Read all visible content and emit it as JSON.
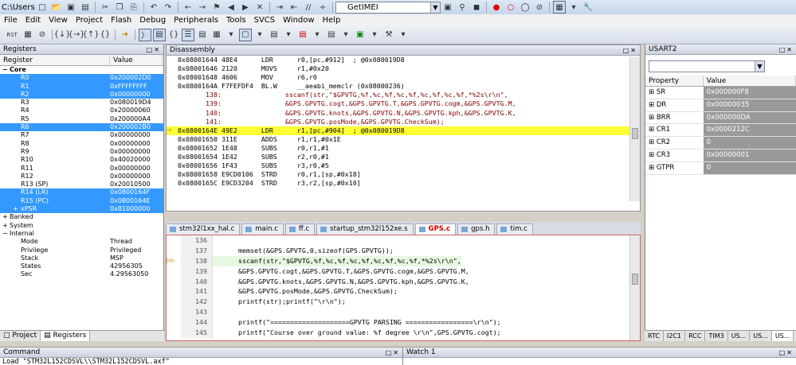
{
  "titlebar": {
    "path": "C:\\Users\\bi",
    "target": "GetIMEI"
  },
  "menu": [
    "File",
    "Edit",
    "View",
    "Project",
    "Flash",
    "Debug",
    "Peripherals",
    "Tools",
    "SVCS",
    "Window",
    "Help"
  ],
  "registers": {
    "title": "Registers",
    "col_register": "Register",
    "col_value": "Value",
    "rows": [
      {
        "name": "Core",
        "value": "",
        "level": 0,
        "exp": "−",
        "bold": true,
        "sel": false
      },
      {
        "name": "R0",
        "value": "0x200002D0",
        "level": 2,
        "exp": "",
        "sel": true
      },
      {
        "name": "R1",
        "value": "0xFFFFFFFF",
        "level": 2,
        "exp": "",
        "sel": true
      },
      {
        "name": "R2",
        "value": "0x00000000",
        "level": 2,
        "exp": "",
        "sel": true
      },
      {
        "name": "R3",
        "value": "0x080019D4",
        "level": 2,
        "exp": "",
        "sel": false
      },
      {
        "name": "R4",
        "value": "0x20000060",
        "level": 2,
        "exp": "",
        "sel": false
      },
      {
        "name": "R5",
        "value": "0x200000A4",
        "level": 2,
        "exp": "",
        "sel": false
      },
      {
        "name": "R6",
        "value": "0x200002B0",
        "level": 2,
        "exp": "",
        "sel": true
      },
      {
        "name": "R7",
        "value": "0x00000000",
        "level": 2,
        "exp": "",
        "sel": false
      },
      {
        "name": "R8",
        "value": "0x00000000",
        "level": 2,
        "exp": "",
        "sel": false
      },
      {
        "name": "R9",
        "value": "0x00000000",
        "level": 2,
        "exp": "",
        "sel": false
      },
      {
        "name": "R10",
        "value": "0x40020000",
        "level": 2,
        "exp": "",
        "sel": false
      },
      {
        "name": "R11",
        "value": "0x00000000",
        "level": 2,
        "exp": "",
        "sel": false
      },
      {
        "name": "R12",
        "value": "0x00000000",
        "level": 2,
        "exp": "",
        "sel": false
      },
      {
        "name": "R13 (SP)",
        "value": "0x20010500",
        "level": 2,
        "exp": "",
        "sel": false
      },
      {
        "name": "R14 (LR)",
        "value": "0x0800164F",
        "level": 2,
        "exp": "",
        "sel": true
      },
      {
        "name": "R15 (PC)",
        "value": "0x0800164E",
        "level": 2,
        "exp": "",
        "sel": true
      },
      {
        "name": "xPSR",
        "value": "0x81000000",
        "level": 2,
        "exp": "+",
        "sel": true
      },
      {
        "name": "Banked",
        "value": "",
        "level": 0,
        "exp": "+",
        "sel": false
      },
      {
        "name": "System",
        "value": "",
        "level": 0,
        "exp": "+",
        "sel": false
      },
      {
        "name": "Internal",
        "value": "",
        "level": 0,
        "exp": "−",
        "sel": false
      },
      {
        "name": "Mode",
        "value": "Thread",
        "level": 2,
        "exp": "",
        "sel": false
      },
      {
        "name": "Privilege",
        "value": "Privileged",
        "level": 2,
        "exp": "",
        "sel": false
      },
      {
        "name": "Stack",
        "value": "MSP",
        "level": 2,
        "exp": "",
        "sel": false
      },
      {
        "name": "States",
        "value": "42956305",
        "level": 2,
        "exp": "",
        "sel": false
      },
      {
        "name": "Sec",
        "value": "4.29563050",
        "level": 2,
        "exp": "",
        "sel": false
      }
    ],
    "tabs": [
      "Project",
      "Registers"
    ]
  },
  "disassembly": {
    "title": "Disassembly",
    "lines": [
      {
        "kind": "asm",
        "text": "0x08001644 48E4      LDR      r0,[pc,#912]  ; @0x080019D8"
      },
      {
        "kind": "asm",
        "text": "0x08001646 2120      MOVS     r1,#0x20"
      },
      {
        "kind": "asm",
        "text": "0x08001648 4606      MOV      r6,r0"
      },
      {
        "kind": "asm",
        "text": "0x0800164A F7FEFDF4  BL.W     __aeabi_memclr (0x08000236)"
      },
      {
        "kind": "src",
        "text": "   138:                sscanf(str,\"$GPVTG,%f,%c,%f,%c,%f,%c,%f,%c,%f,*%2s\\r\\n\","
      },
      {
        "kind": "src",
        "text": "   139:                &GPS.GPVTG.cogt,&GPS.GPVTG.T,&GPS.GPVTG.cogm,&GPS.GPVTG.M,"
      },
      {
        "kind": "src",
        "text": "   140:                &GPS.GPVTG.knots,&GPS.GPVTG.N,&GPS.GPVTG.kph,&GPS.GPVTG.K,"
      },
      {
        "kind": "src",
        "text": "   141:                &GPS.GPVTG.posMode,&GPS.GPVTG.CheckSum);"
      },
      {
        "kind": "cur",
        "text": "0x0800164E 49E2      LDR      r1,[pc,#904]  ; @0x080019D8"
      },
      {
        "kind": "asm",
        "text": "0x08001650 311E      ADDS     r1,r1,#0x1E"
      },
      {
        "kind": "asm",
        "text": "0x08001652 1E48      SUBS     r0,r1,#1"
      },
      {
        "kind": "asm",
        "text": "0x08001654 1E42      SUBS     r2,r0,#1"
      },
      {
        "kind": "asm",
        "text": "0x08001656 1F43      SUBS     r3,r0,#5"
      },
      {
        "kind": "asm",
        "text": "0x08001658 E9CD0106  STRD     r0,r1,[sp,#0x18]"
      },
      {
        "kind": "asm",
        "text": "0x0800165C E9CD3204  STRD     r3,r2,[sp,#0x10]"
      }
    ]
  },
  "editor": {
    "tabs": [
      {
        "label": "stm32l1xx_hal.c",
        "active": false
      },
      {
        "label": "main.c",
        "active": false
      },
      {
        "label": "ff.c",
        "active": false
      },
      {
        "label": "startup_stm32l152xe.s",
        "active": false
      },
      {
        "label": "GPS.c",
        "active": true
      },
      {
        "label": "gps.h",
        "active": false
      },
      {
        "label": "tim.c",
        "active": false
      }
    ],
    "lines": [
      {
        "num": "136",
        "text": "",
        "hl": false
      },
      {
        "num": "137",
        "text": "memset(&GPS.GPVTG,0,sizeof(GPS.GPVTG));",
        "hl": false
      },
      {
        "num": "138",
        "text": "sscanf(str,\"$GPVTG,%f,%c,%f,%c,%f,%c,%f,%c,%f,*%2s\\r\\n\",",
        "hl": true
      },
      {
        "num": "139",
        "text": "&GPS.GPVTG.cogt,&GPS.GPVTG.T,&GPS.GPVTG.cogm,&GPS.GPVTG.M,",
        "hl": false
      },
      {
        "num": "140",
        "text": "&GPS.GPVTG.knots,&GPS.GPVTG.N,&GPS.GPVTG.kph,&GPS.GPVTG.K,",
        "hl": false
      },
      {
        "num": "141",
        "text": "&GPS.GPVTG.posMode,&GPS.GPVTG.CheckSum);",
        "hl": false
      },
      {
        "num": "142",
        "text": "printf(str);printf(\"\\r\\n\");",
        "hl": false
      },
      {
        "num": "143",
        "text": "",
        "hl": false
      },
      {
        "num": "144",
        "text": "printf(\"====================GPVTG PARSING =================\\r\\n\");",
        "hl": false
      },
      {
        "num": "145",
        "text": "printf(\"Course over ground value: %f degree \\r\\n\",GPS.GPVTG.cogt);",
        "hl": false
      }
    ]
  },
  "usart": {
    "title": "USART2",
    "col_property": "Property",
    "col_value": "Value",
    "rows": [
      {
        "name": "SR",
        "value": "0x000000F8"
      },
      {
        "name": "DR",
        "value": "0x00000035"
      },
      {
        "name": "BRR",
        "value": "0x000000DA"
      },
      {
        "name": "CR1",
        "value": "0x0000212C"
      },
      {
        "name": "CR2",
        "value": "0"
      },
      {
        "name": "CR3",
        "value": "0x00000001"
      },
      {
        "name": "GTPR",
        "value": "0"
      }
    ],
    "tabs": [
      "RTC",
      "I2C1",
      "RCC",
      "TIM3",
      "US...",
      "US...",
      "US..."
    ]
  },
  "command": {
    "title": "Command",
    "text": "Load \"STM32L152CDSVL\\\\STM32L152CDSVL.axf\""
  },
  "watch": {
    "title": "Watch 1"
  }
}
